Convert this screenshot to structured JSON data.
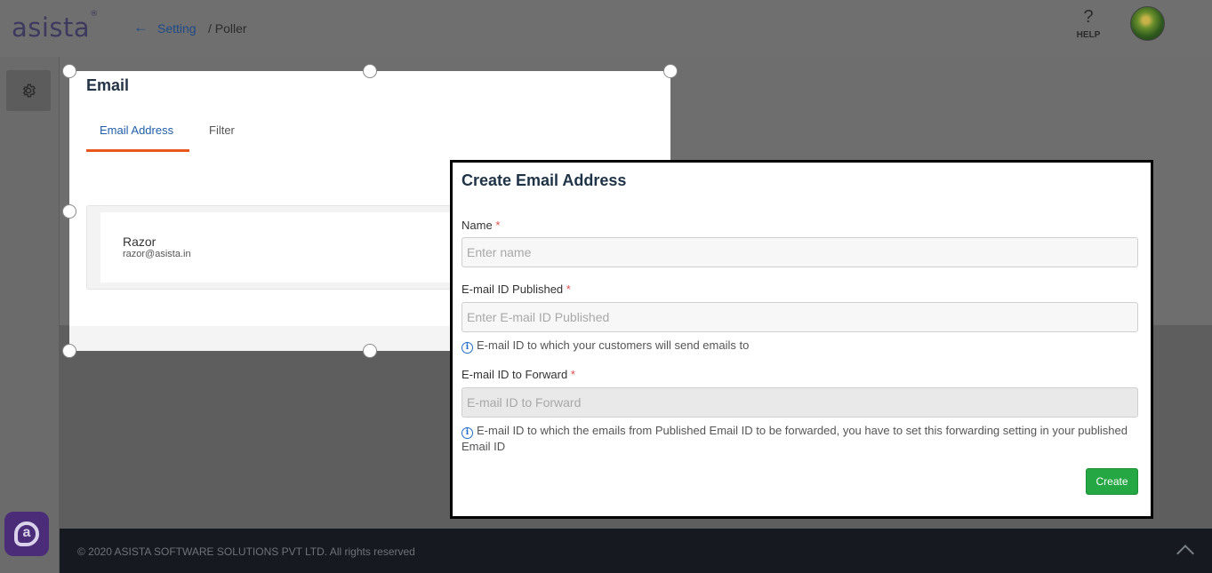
{
  "app": {
    "logo_text": "asista",
    "logo_mark": "®"
  },
  "header": {
    "back_icon": "arrow-left-icon",
    "breadcrumb": {
      "setting": "Setting",
      "current": "/ Poller"
    },
    "help_icon": "?",
    "help_label": "HELP",
    "avatar_icon": "user-avatar"
  },
  "sidebar": {
    "settings_icon": "gear-icon",
    "chat_icon": "asista-chat-icon"
  },
  "panel": {
    "title": "Email",
    "tabs": [
      {
        "label": "Email Address",
        "active": true
      },
      {
        "label": "Filter",
        "active": false
      }
    ],
    "entries": [
      {
        "name": "Razor",
        "email": "razor@asista.in"
      }
    ]
  },
  "modal": {
    "title": "Create Email Address",
    "fields": [
      {
        "label": "Name",
        "required_mark": "*",
        "placeholder": "Enter name",
        "value": ""
      },
      {
        "label": "E-mail ID Published",
        "required_mark": "*",
        "placeholder": "Enter E-mail ID Published",
        "value": "",
        "hint": "E-mail ID to which your customers will send emails to"
      },
      {
        "label": "E-mail ID to Forward",
        "required_mark": "*",
        "placeholder": "E-mail ID to Forward",
        "value": "",
        "disabled": true,
        "hint": "E-mail ID to which the emails from Published Email ID to be forwarded, you have to set this forwarding setting in your published Email ID"
      }
    ],
    "submit_label": "Create"
  },
  "footer": {
    "copyright": "© 2020 ASISTA SOFTWARE SOLUTIONS PVT LTD. All rights reserved",
    "scroll_top_icon": "chevron-up-icon"
  },
  "colors": {
    "accent_blue": "#1f5fa8",
    "tab_underline": "#e8581e",
    "create_button": "#25a744",
    "required": "#e05050",
    "brand_purple": "#4a2c78"
  }
}
